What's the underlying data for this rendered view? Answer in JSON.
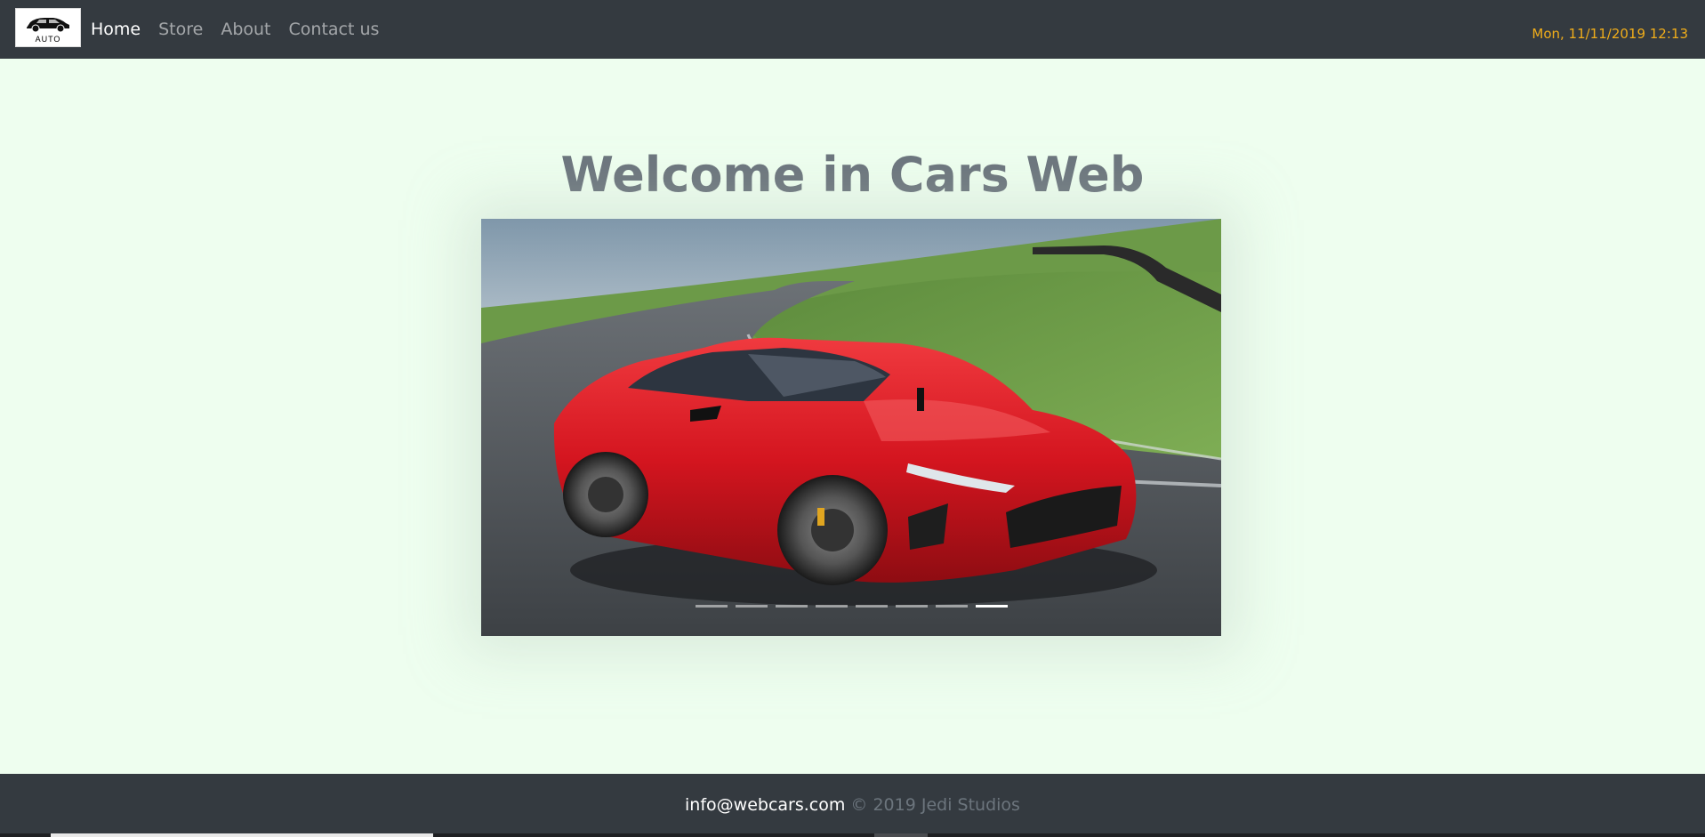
{
  "navbar": {
    "brand_text": "AUTO",
    "links": [
      {
        "label": "Home",
        "active": true
      },
      {
        "label": "Store",
        "active": false
      },
      {
        "label": "About",
        "active": false
      },
      {
        "label": "Contact us",
        "active": false
      }
    ],
    "datetime": "Mon, 11/11/2019 12:13",
    "background": "#343a40",
    "datetime_color": "#f0ad1a"
  },
  "main": {
    "title": "Welcome in Cars Web",
    "carousel": {
      "image_subject": "red sports car on race track",
      "indicator_count": 8,
      "active_index": 7
    }
  },
  "footer": {
    "email": "info@webcars.com",
    "copyright": "© 2019 Jedi Studios"
  },
  "colors": {
    "page_background": "#eefeef",
    "title": "#6c757d",
    "car_red": "#d4151f"
  }
}
